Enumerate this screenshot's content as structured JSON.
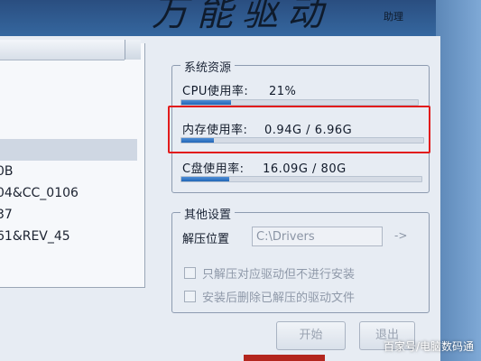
{
  "header": {
    "title": "万能驱动",
    "subtitle": "助理"
  },
  "device_list": {
    "rows": [
      "0B",
      "04&CC_0106",
      "37",
      "61&REV_45"
    ]
  },
  "system_resources": {
    "group_title": "系统资源",
    "cpu": {
      "label": "CPU使用率:",
      "value": "21%",
      "level": 0.21
    },
    "memory": {
      "label": "内存使用率:",
      "value": "0.94G / 6.96G",
      "level": 0.135
    },
    "disk": {
      "label": "C盘使用率:",
      "value": "16.09G / 80G",
      "level": 0.2
    }
  },
  "other_settings": {
    "group_title": "其他设置",
    "extract_label": "解压位置",
    "extract_path": "C:\\Drivers",
    "browse_icon": "arrow-right-icon",
    "option_extract_only": "只解压对应驱动但不进行安装",
    "option_delete_after": "安装后删除已解压的驱动文件"
  },
  "buttons": {
    "start": "开始",
    "exit": "退出"
  },
  "watermark": "百家号/电脑数码通",
  "colors": {
    "bar_fill": "#2266b6",
    "highlight": "#e21b1b"
  }
}
